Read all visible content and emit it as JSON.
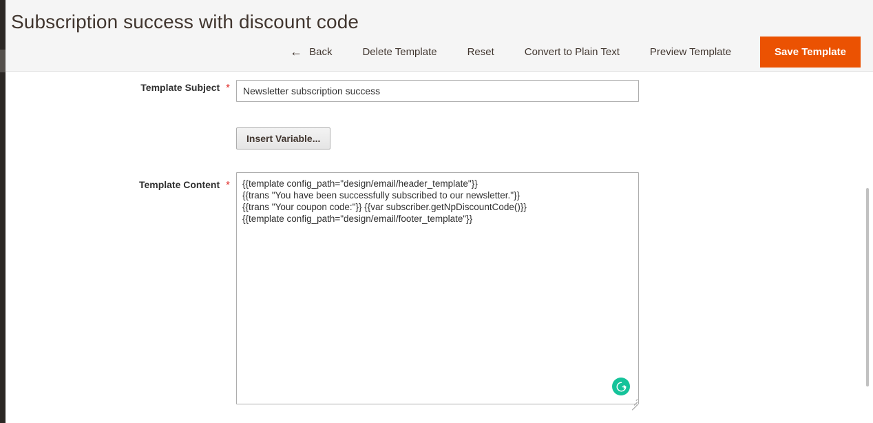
{
  "page": {
    "title": "Subscription success with discount code"
  },
  "toolbar": {
    "back_icon": "arrow-left-icon",
    "back_label": "Back",
    "delete_label": "Delete Template",
    "reset_label": "Reset",
    "convert_label": "Convert to Plain Text",
    "preview_label": "Preview Template",
    "save_label": "Save Template",
    "save_color": "#eb5202"
  },
  "form": {
    "subject": {
      "label": "Template Subject",
      "required_marker": "*",
      "value": "Newsletter subscription success",
      "placeholder": ""
    },
    "insert_variable": {
      "label": "Insert Variable..."
    },
    "content": {
      "label": "Template Content",
      "required_marker": "*",
      "value": "{{template config_path=\"design/email/header_template\"}}\n{{trans \"You have been successfully subscribed to our newsletter.\"}}\n{{trans \"Your coupon code:\"}} {{var subscriber.getNpDiscountCode()}}\n{{template config_path=\"design/email/footer_template\"}}",
      "placeholder": ""
    },
    "grammarly_badge": "grammarly-icon"
  },
  "theme": {
    "rail_color": "#2b2724",
    "header_bg": "#f5f5f5",
    "text_color": "#41362f",
    "required_color": "#e02b27",
    "grammarly_green": "#15c39a"
  }
}
